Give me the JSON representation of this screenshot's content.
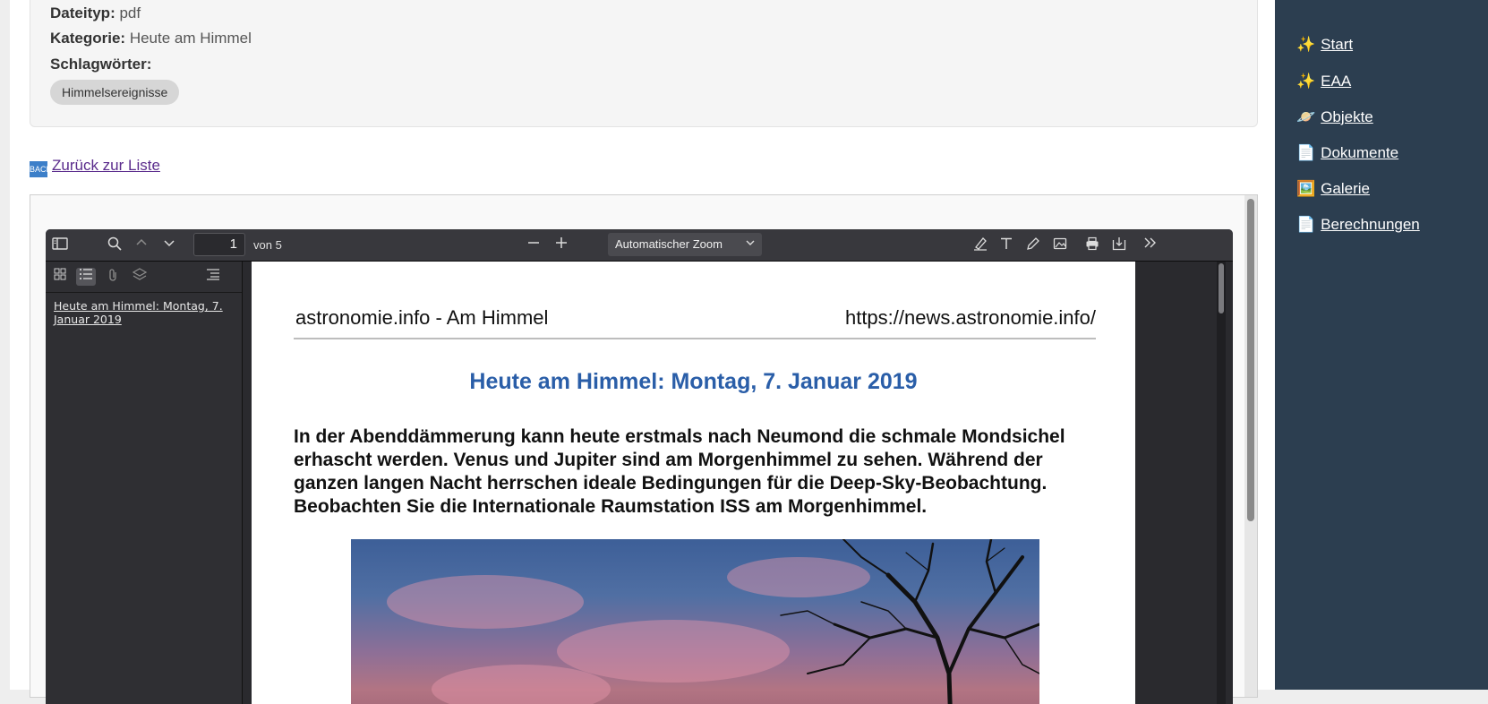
{
  "meta": {
    "filetype_label": "Dateityp:",
    "filetype_value": "pdf",
    "category_label": "Kategorie:",
    "category_value": "Heute am Himmel",
    "tags_label": "Schlagwörter:",
    "tags": [
      "Himmelsereignisse"
    ]
  },
  "back_link": {
    "icon": "🔙",
    "label": "Zurück zur Liste"
  },
  "pdf_viewer": {
    "page_number": "1",
    "page_of": "von 5",
    "zoom": "Automatischer Zoom",
    "outline": [
      "Heute am Himmel: Montag, 7. Januar 2019"
    ],
    "page": {
      "header_left": "astronomie.info - Am Himmel",
      "header_right": "https://news.astronomie.info/",
      "title": "Heute am Himmel: Montag, 7. Januar 2019",
      "lead": "In der Abenddämmerung kann heute erstmals nach Neumond die schmale Mondsichel erhascht werden. Venus und Jupiter sind am Morgenhimmel zu sehen. Während der ganzen langen Nacht herrschen ideale Bedingungen für die Deep-Sky-Beobachtung. Beobachten Sie die Internationale Raumstation ISS am Morgenhimmel."
    }
  },
  "nav": {
    "items": [
      {
        "emoji": "✨",
        "label": "Start"
      },
      {
        "emoji": "✨",
        "label": "EAA"
      },
      {
        "emoji": "🪐",
        "label": "Objekte"
      },
      {
        "emoji": "📄",
        "label": "Dokumente"
      },
      {
        "emoji": "🖼️",
        "label": "Galerie"
      },
      {
        "emoji": "📄",
        "label": "Berechnungen"
      }
    ]
  },
  "colors": {
    "nav_bg": "#2c3e50",
    "title_blue": "#2a5ea8",
    "link_visited": "#5a2b8c"
  }
}
